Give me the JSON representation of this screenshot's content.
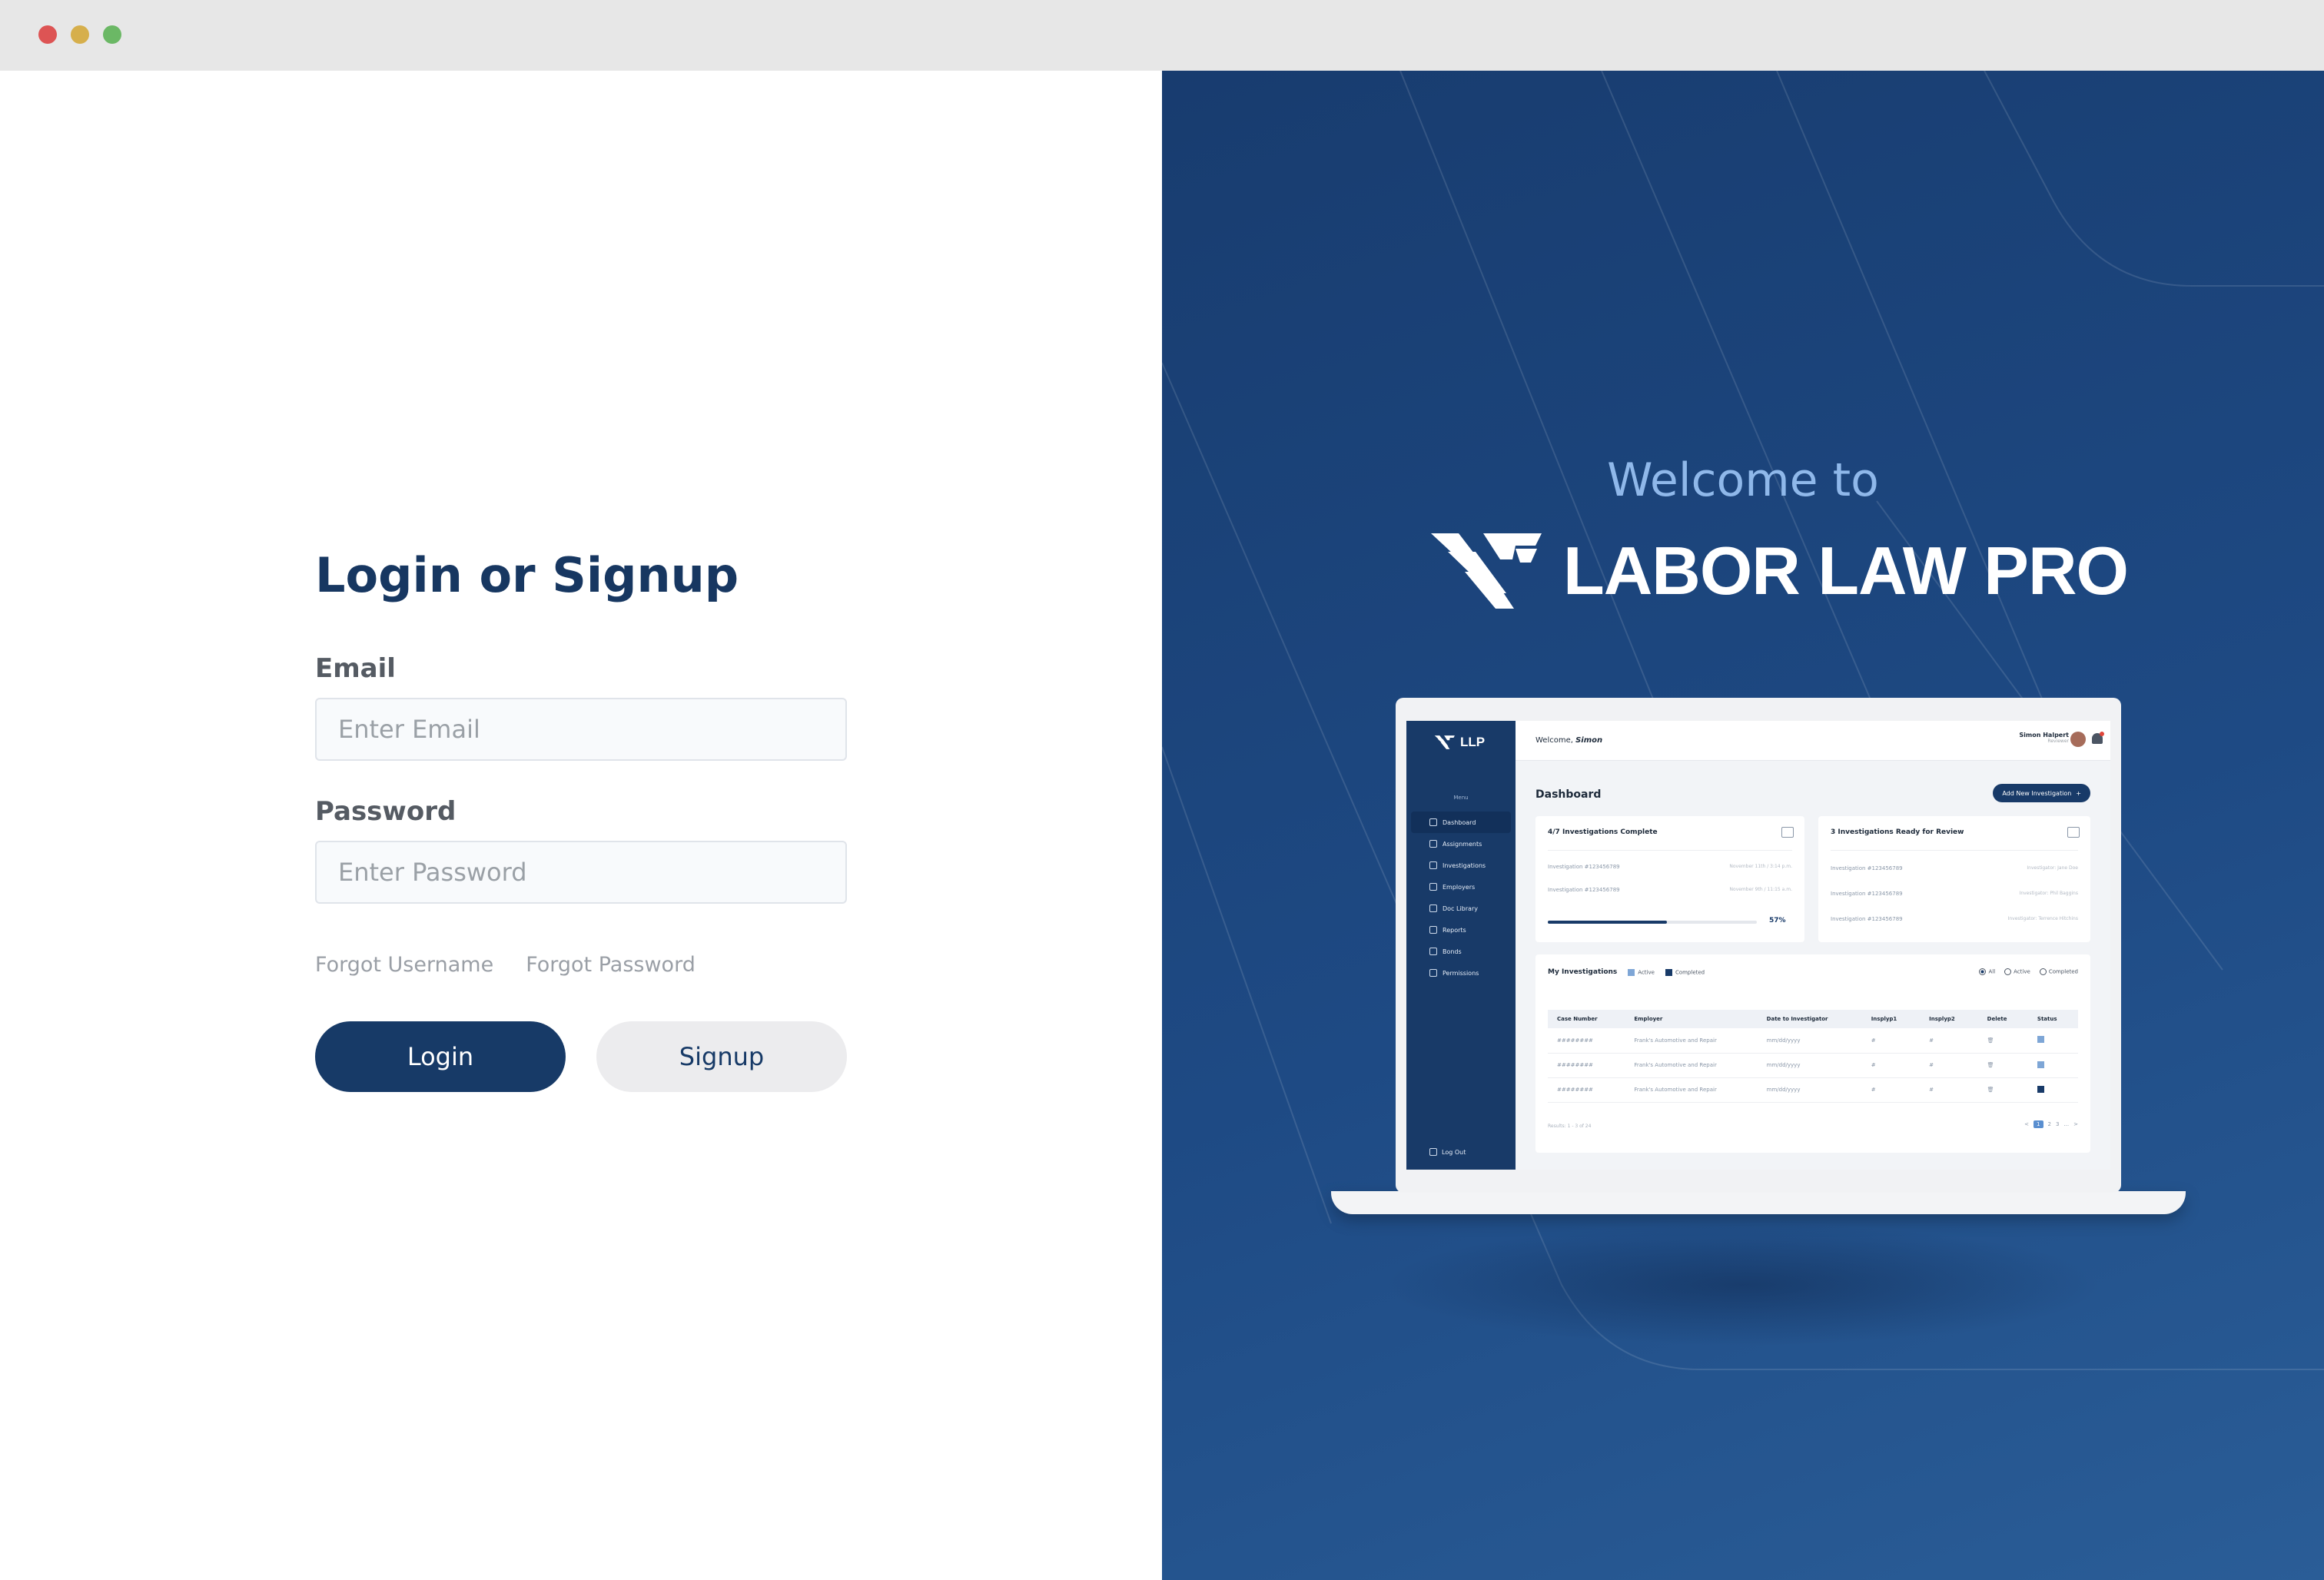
{
  "window": {
    "controls": [
      "close",
      "minimize",
      "zoom"
    ]
  },
  "form": {
    "title": "Login or Signup",
    "email_label": "Email",
    "email_placeholder": "Enter Email",
    "password_label": "Password",
    "password_placeholder": "Enter Password",
    "forgot_username": "Forgot Username",
    "forgot_password": "Forgot Password",
    "login_label": "Login",
    "signup_label": "Signup"
  },
  "hero": {
    "welcome": "Welcome to",
    "brand_name": "LABOR LAW PRO"
  },
  "preview": {
    "logo_text": "LLP",
    "menu_label": "Menu",
    "nav": [
      "Dashboard",
      "Assignments",
      "Investigations",
      "Employers",
      "Doc Library",
      "Reports",
      "Bonds",
      "Permissions"
    ],
    "logout": "Log Out",
    "welcome_prefix": "Welcome,",
    "welcome_name": "Simon",
    "user_name": "Simon Halpert",
    "user_role": "Reviewer",
    "page_title": "Dashboard",
    "add_button": "Add New Investigation",
    "add_icon": "+",
    "card1_title": "4/7 Investigations Complete",
    "card1_rows": [
      {
        "label": "Investigation #123456789",
        "meta": "November 11th / 3:14 p.m."
      },
      {
        "label": "Investigation #123456789",
        "meta": "November 9th / 11:15 a.m."
      }
    ],
    "progress_pct": 57,
    "progress_label": "57%",
    "card2_title": "3 Investigations Ready for Review",
    "card2_rows": [
      {
        "label": "Investigation #123456789",
        "meta": "Investigator: Jane Doe"
      },
      {
        "label": "Investigation #123456789",
        "meta": "Investigator: Phil Baggins"
      },
      {
        "label": "Investigation #123456789",
        "meta": "Investigator: Terrence Hitchins"
      }
    ],
    "table_title": "My Investigations",
    "legend_active": "Active",
    "legend_completed": "Completed",
    "filter_all": "All",
    "filter_active": "Active",
    "filter_completed": "Completed",
    "columns": [
      "Case Number",
      "Employer",
      "Date to Investigator",
      "Insplyp1",
      "Insplyp2",
      "Delete",
      "Status"
    ],
    "rows": [
      {
        "case": "########",
        "employer": "Frank's Automotive and Repair",
        "date": "mm/dd/yyyy",
        "p1": "#",
        "p2": "#",
        "status_color": "#7ea6d6"
      },
      {
        "case": "########",
        "employer": "Frank's Automotive and Repair",
        "date": "mm/dd/yyyy",
        "p1": "#",
        "p2": "#",
        "status_color": "#7ea6d6"
      },
      {
        "case": "########",
        "employer": "Frank's Automotive and Repair",
        "date": "mm/dd/yyyy",
        "p1": "#",
        "p2": "#",
        "status_color": "#183a68"
      }
    ],
    "results_text": "Results: 1 - 3 of 24",
    "pages": [
      "<",
      "1",
      "2",
      "3",
      "...",
      ">"
    ]
  },
  "colors": {
    "brand_navy": "#173a67",
    "hero_bg": "#1e4a84",
    "welcome_text": "#8fb8ea"
  }
}
